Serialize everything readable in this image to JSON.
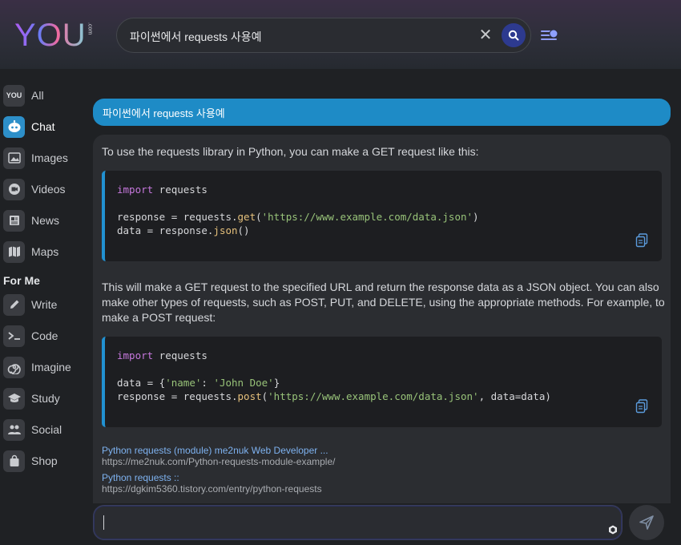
{
  "header": {
    "logo_text": "YOU",
    "logo_suffix": ".com",
    "search_value": "파이썬에서 requests 사용예",
    "clear_symbol": "✕"
  },
  "sidebar": {
    "items": [
      {
        "label": "All",
        "icon": "you-icon",
        "active": false
      },
      {
        "label": "Chat",
        "icon": "chat-bot-icon",
        "active": true
      },
      {
        "label": "Images",
        "icon": "image-icon",
        "active": false
      },
      {
        "label": "Videos",
        "icon": "video-icon",
        "active": false
      },
      {
        "label": "News",
        "icon": "newspaper-icon",
        "active": false
      },
      {
        "label": "Maps",
        "icon": "map-icon",
        "active": false
      }
    ],
    "section_title": "For Me",
    "for_me_items": [
      {
        "label": "Write",
        "icon": "pencil-icon"
      },
      {
        "label": "Code",
        "icon": "terminal-icon"
      },
      {
        "label": "Imagine",
        "icon": "spiral-icon"
      },
      {
        "label": "Study",
        "icon": "graduation-cap-icon"
      },
      {
        "label": "Social",
        "icon": "people-icon"
      },
      {
        "label": "Shop",
        "icon": "shopping-bag-icon"
      }
    ],
    "all_icon_text": "YOU"
  },
  "chat": {
    "user_message": "파이썬에서 requests 사용예",
    "intro": "To use the requests library in Python, you can make a GET request like this:",
    "code1": {
      "l1_kw": "import",
      "l1_rest": " requests",
      "l2_a": "response = requests.",
      "l2_fn": "get",
      "l2_b": "(",
      "l2_str": "'https://www.example.com/data.json'",
      "l2_c": ")",
      "l3_a": "data = response.",
      "l3_fn": "json",
      "l3_b": "()"
    },
    "middle_line1": "This will make a GET request to the specified URL and return the response data as a JSON object. You can also",
    "middle_line2": "make other types of requests, such as POST, PUT, and DELETE, using the appropriate methods. For example, to",
    "middle_line3": "make a POST request:",
    "code2": {
      "l1_kw": "import",
      "l1_rest": " requests",
      "l2_a": "data = {",
      "l2_s1": "'name'",
      "l2_b": ": ",
      "l2_s2": "'John Doe'",
      "l2_c": "}",
      "l3_a": "response = requests.",
      "l3_fn": "post",
      "l3_b": "(",
      "l3_str": "'https://www.example.com/data.json'",
      "l3_c": ", data=data)"
    },
    "sources": [
      {
        "title": "Python requests (module) me2nuk Web Developer ...",
        "url": "https://me2nuk.com/Python-requests-module-example/"
      },
      {
        "title": "Python requests ::",
        "url": "https://dgkim5360.tistory.com/entry/python-requests"
      }
    ]
  },
  "input": {
    "value": ""
  },
  "colors": {
    "accent": "#1e8bc6",
    "keyword": "#c678dd",
    "function": "#e5c07b",
    "string": "#98c379",
    "link": "#7eb2f0"
  }
}
